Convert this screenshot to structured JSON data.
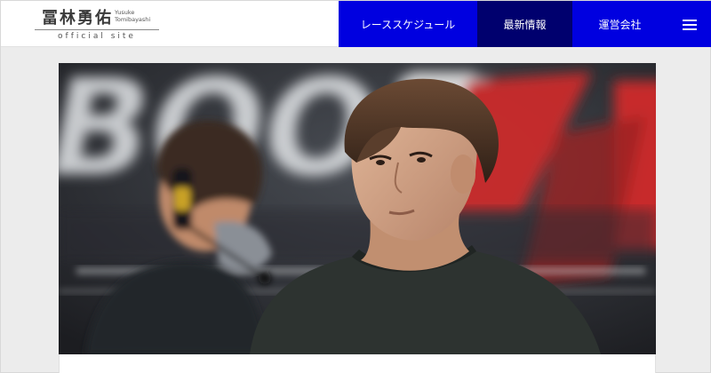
{
  "logo": {
    "name": "冨林勇佑",
    "romaji_line1": "Yusuke",
    "romaji_line2": "Tomibayashi",
    "subtitle": "official site"
  },
  "nav": {
    "items": [
      {
        "label": "レーススケジュール",
        "active": false
      },
      {
        "label": "最新情報",
        "active": true
      },
      {
        "label": "運営会社",
        "active": false
      }
    ],
    "menu_icon": "hamburger-menu-icon"
  },
  "hero": {
    "image": "photo of two racing drivers in a pit, one wearing a headset and mask in the background, one looking upward in the foreground",
    "background_text": "BOOK"
  },
  "colors": {
    "nav_blue": "#0000e0",
    "nav_active": "#00006e",
    "page_bg": "#ececec"
  }
}
